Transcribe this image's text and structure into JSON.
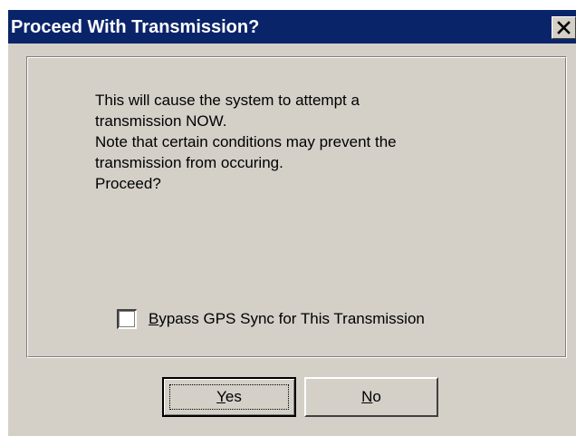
{
  "dialog": {
    "title": "Proceed With Transmission?",
    "close_icon": "close-x-icon",
    "message_lines": [
      "This will cause the system to attempt a",
      "transmission NOW.",
      "Note that certain conditions may prevent the",
      "transmission from occuring.",
      "Proceed?"
    ],
    "checkbox": {
      "access_key": "B",
      "label_rest": "ypass GPS Sync for This Transmission",
      "checked": false
    },
    "buttons": {
      "yes_key": "Y",
      "yes_rest": "es",
      "no_key": "N",
      "no_rest": "o"
    }
  },
  "colors": {
    "titlebar": "#0a246a",
    "face": "#d4d0c8"
  }
}
